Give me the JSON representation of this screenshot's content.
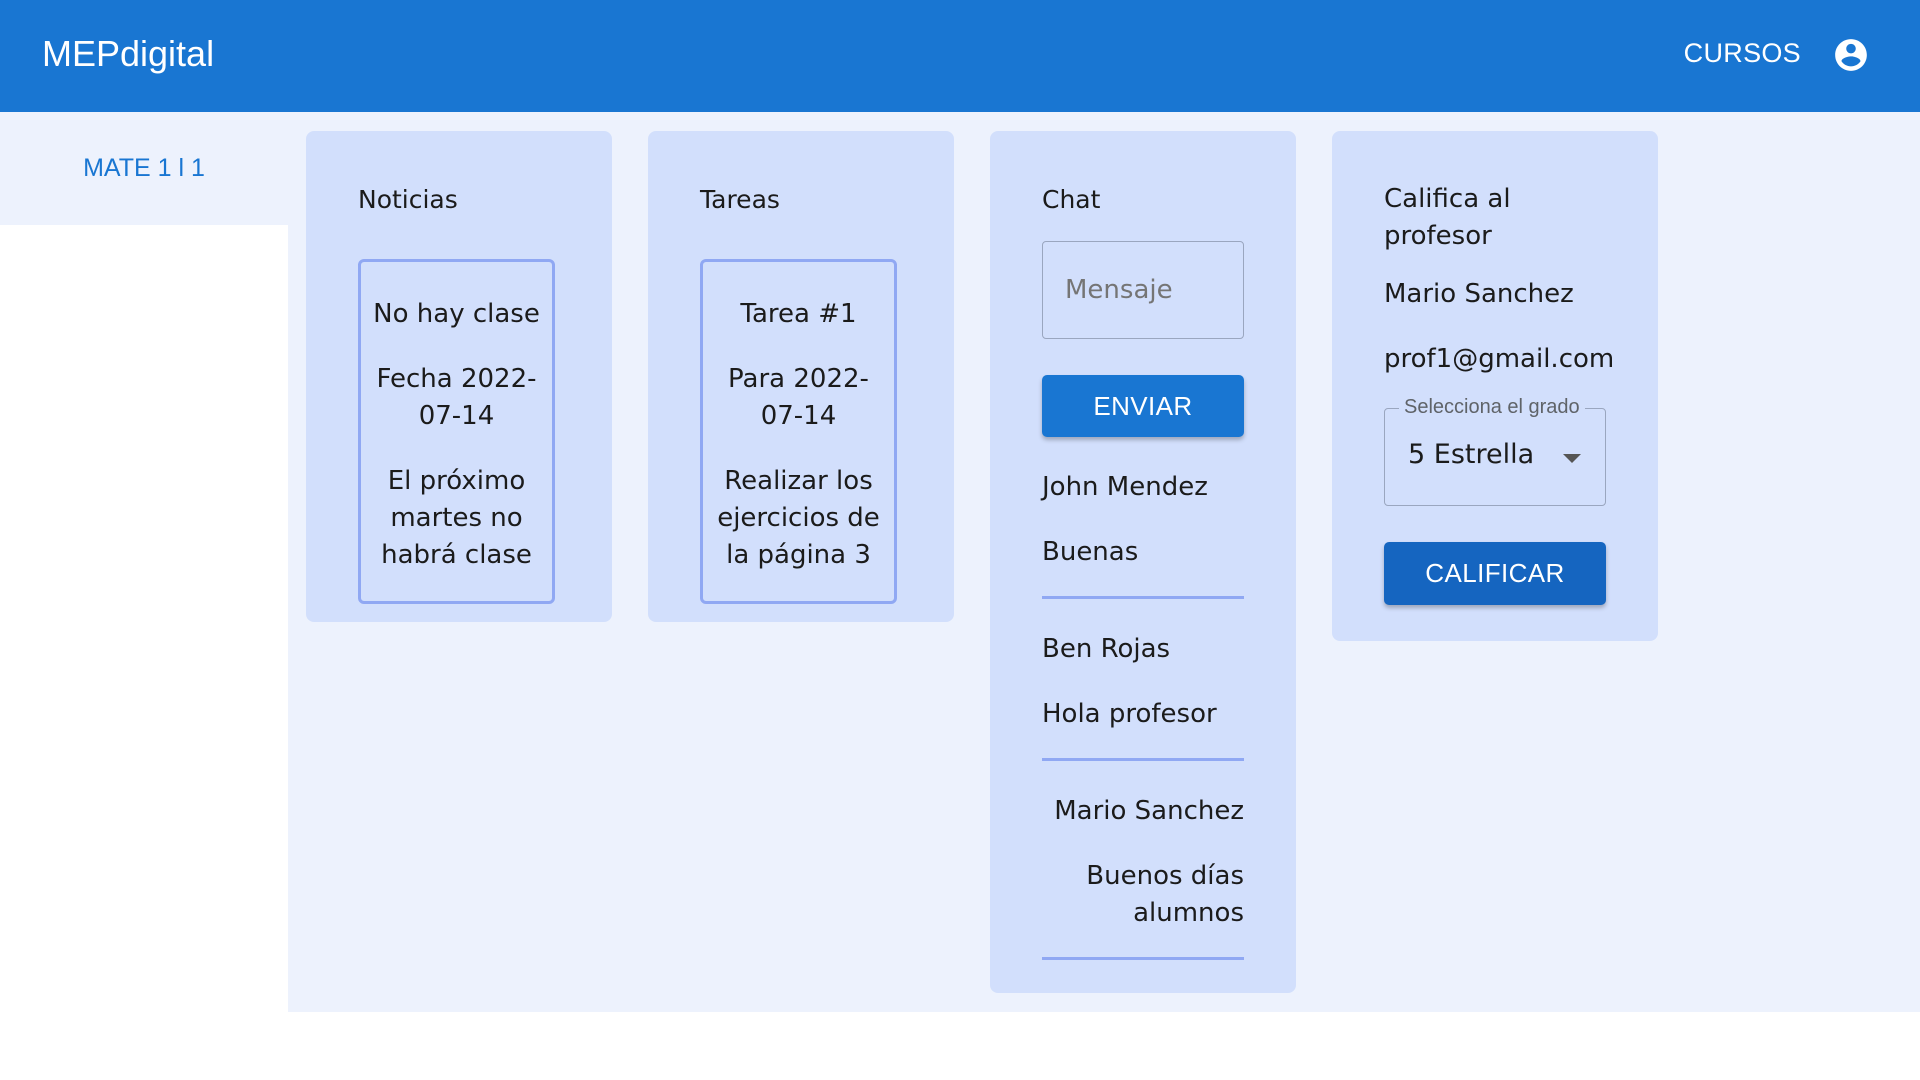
{
  "appbar": {
    "brand": "MEPdigital",
    "nav_label": "CURSOS",
    "account_icon": "account-circle-icon"
  },
  "sidebar": {
    "items": [
      {
        "label": "MATE 1 l 1"
      }
    ]
  },
  "noticias": {
    "title": "Noticias",
    "items": [
      {
        "title": "No hay clase",
        "date": "Fecha 2022-07-14",
        "body": "El próximo martes no habrá clase"
      }
    ]
  },
  "tareas": {
    "title": "Tareas",
    "items": [
      {
        "title": "Tarea #1",
        "due": "Para 2022-07-14",
        "body": "Realizar los ejercicios de la página 3"
      }
    ]
  },
  "chat": {
    "title": "Chat",
    "input_placeholder": "Mensaje",
    "input_value": "",
    "send_label": "ENVIAR",
    "messages": [
      {
        "author": "John Mendez",
        "text": "Buenas"
      },
      {
        "author": "Ben Rojas",
        "text": "Hola profesor"
      },
      {
        "author": "Mario Sanchez",
        "text": "Buenos días alumnos"
      }
    ]
  },
  "rating": {
    "title": "Califica al profesor",
    "teacher_name": "Mario Sanchez",
    "teacher_email": "prof1@gmail.com",
    "select_label": "Selecciona el grado",
    "select_value": "5 Estrella",
    "submit_label": "CALIFICAR"
  },
  "colors": {
    "primary": "#1976d2",
    "card_background": "#d2dffc",
    "page_background": "#edf2fd",
    "accent_border": "#90a8f3"
  }
}
